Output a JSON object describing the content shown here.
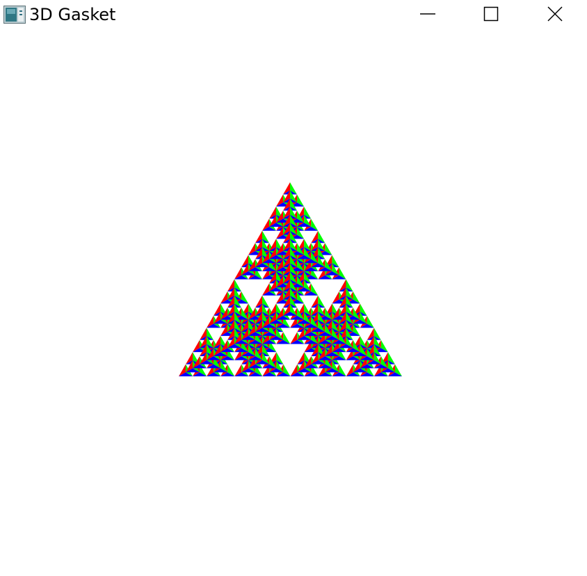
{
  "window": {
    "title": "3D Gasket",
    "app_icon": "opengl-app-icon",
    "controls": {
      "minimize": "minimize-icon",
      "maximize": "maximize-icon",
      "close": "close-icon"
    }
  },
  "canvas": {
    "background": "#ffffff",
    "figure": "sierpinski-gasket-3d",
    "subdivisions": 4,
    "face_colors": [
      "#ff0000",
      "#00ff00",
      "#0000ff"
    ]
  }
}
